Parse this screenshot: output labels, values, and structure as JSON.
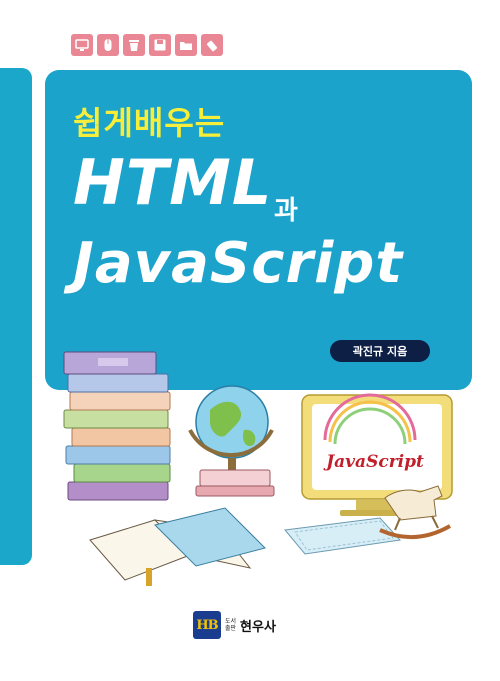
{
  "cover": {
    "subtitle": "쉽게배우는",
    "title_main": "HTML",
    "title_conjunction": "과",
    "title_second": "JavaScript",
    "author": "곽진규 지음",
    "screen_label": "JavaScript"
  },
  "icons": [
    "computer-icon",
    "mouse-icon",
    "trash-icon",
    "floppy-disk-icon",
    "folder-icon",
    "usb-drive-icon"
  ],
  "publisher": {
    "logo_text": "HB",
    "label_line1": "도서",
    "label_line2": "출판",
    "name": "현우사"
  },
  "colors": {
    "accent_blue": "#1ba3cc",
    "subtitle_yellow": "#f6ee3a",
    "icon_pink": "#e98794",
    "badge_navy": "#0d1f45"
  }
}
